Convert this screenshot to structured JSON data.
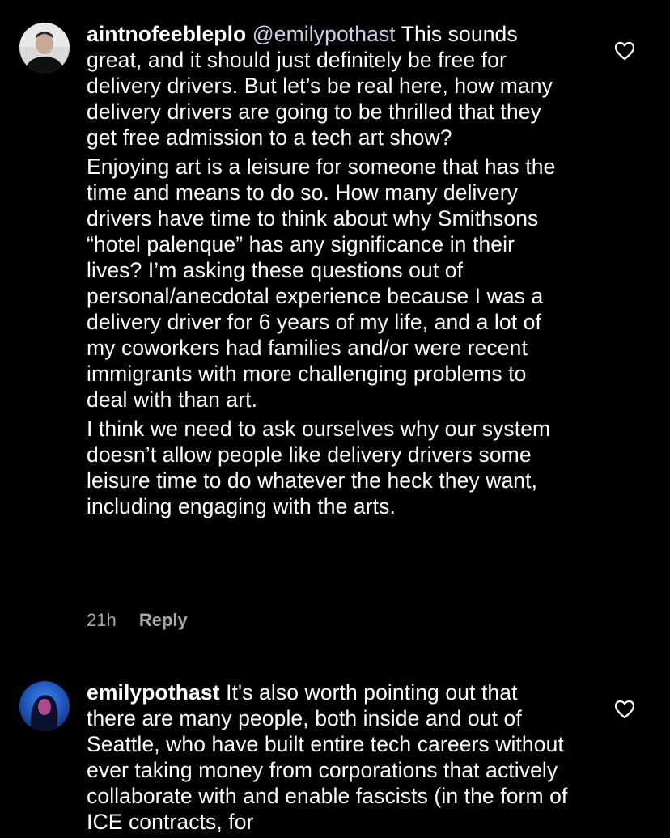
{
  "comments": [
    {
      "username": "aintnofeebleplo",
      "mention": "@emilypothast",
      "first_text": "This sounds great, and it should just definitely be free for delivery drivers. But let’s be real here, how many delivery drivers are going to be thrilled that they get free admission to a tech art show?",
      "paragraph_2": "Enjoying art is a leisure for someone that has the time and means to do so. How many delivery drivers have time to think about why Smithsons “hotel palenque” has any significance in their lives?  I’m asking these questions out of personal/anecdotal experience because I was a delivery driver for 6 years of my life, and a lot of my coworkers had families and/or were recent immigrants with more challenging problems to deal with than art.",
      "paragraph_3": "I think we need to ask ourselves why our system doesn’t allow people like delivery drivers some leisure time to do whatever the heck they want, including engaging with the arts.",
      "time": "21h",
      "reply_label": "Reply",
      "avatar_icon": "person-portrait-icon"
    },
    {
      "username": "emilypothast",
      "first_text": "It's also worth pointing out that there are many people, both inside and out of Seattle, who have built entire tech careers without ever taking money from corporations that actively collaborate with and enable fascists (in the form of ICE contracts, for",
      "avatar_icon": "person-portrait-icon"
    }
  ],
  "icons": {
    "like": "heart-outline-icon"
  },
  "colors": {
    "background": "#000000",
    "text": "#ffffff",
    "meta": "#a8a8a8",
    "mention": "#c9d3e6"
  }
}
